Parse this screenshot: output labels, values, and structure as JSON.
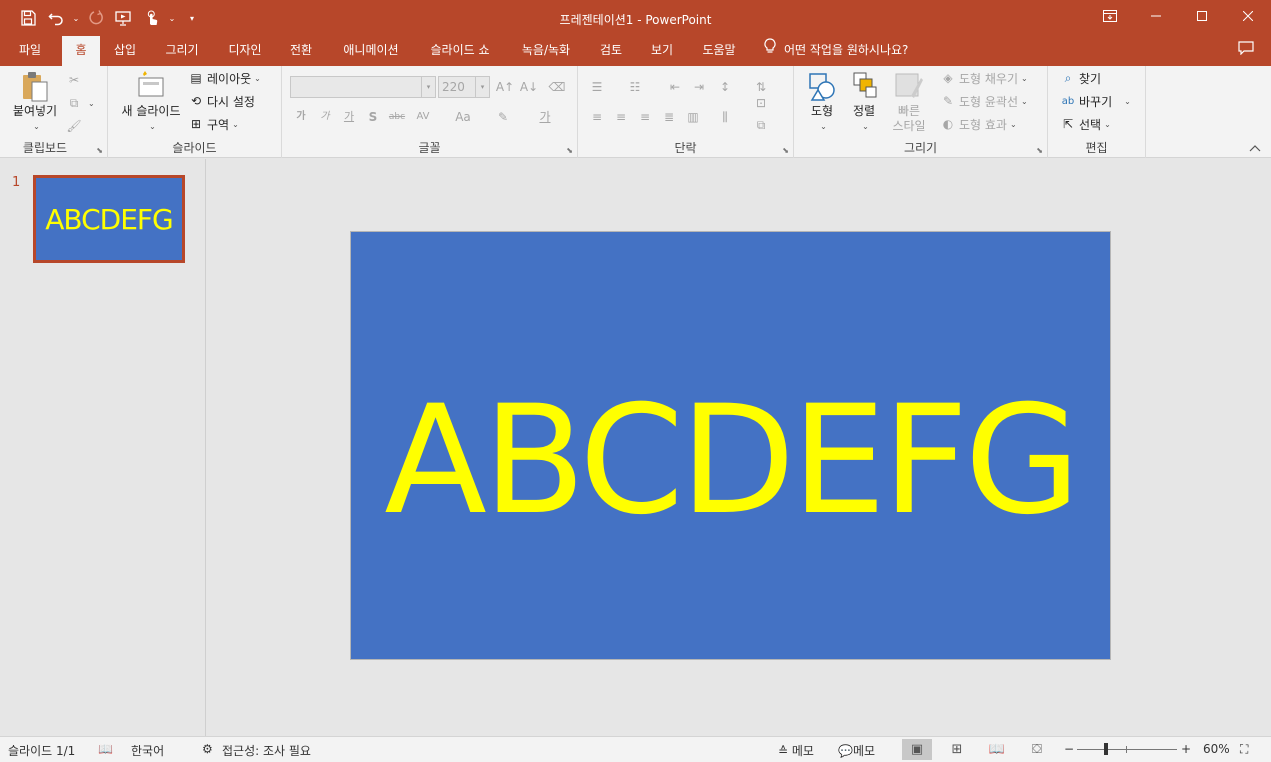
{
  "window": {
    "title": "프레젠테이션1 - PowerPoint"
  },
  "colors": {
    "accent": "#b7472a",
    "slide_bg": "#4472c4",
    "slide_text": "#ffff00",
    "ribbon_bg": "#f3f3f3"
  },
  "qat": {
    "save_icon": "save-icon",
    "undo_icon": "undo-icon",
    "redo_icon": "redo-icon",
    "present_icon": "present-from-start-icon",
    "touch_icon": "touch-mouse-mode-icon",
    "customize_icon": "customize-qat-icon"
  },
  "window_controls": {
    "ribbon_display": "ribbon-display-options-icon",
    "minimize": "minimize-icon",
    "maximize": "maximize-icon",
    "close": "close-icon"
  },
  "tabs": [
    "파일",
    "홈",
    "삽입",
    "그리기",
    "디자인",
    "전환",
    "애니메이션",
    "슬라이드 쇼",
    "녹음/녹화",
    "검토",
    "보기",
    "도움말"
  ],
  "active_tab": "홈",
  "tell_me": "어떤 작업을 원하시나요?",
  "ribbon": {
    "clipboard": {
      "label": "클립보드",
      "paste": "붙여넣기"
    },
    "slides": {
      "label": "슬라이드",
      "new_slide": "새 슬라이드",
      "layout": "레이아웃",
      "reset": "다시 설정",
      "section": "구역"
    },
    "font": {
      "label": "글꼴",
      "font_size": "220",
      "bold": "가",
      "italic": "가",
      "underline": "가",
      "shadow": "S",
      "strike": "abc",
      "spacing": "AV",
      "case": "Aa",
      "color": "가"
    },
    "paragraph": {
      "label": "단락"
    },
    "drawing": {
      "label": "그리기",
      "shapes": "도형",
      "arrange": "정렬",
      "quick_styles_1": "빠른",
      "quick_styles_2": "스타일",
      "fill": "도형 채우기",
      "outline": "도형 윤곽선",
      "effects": "도형 효과"
    },
    "editing": {
      "label": "편집",
      "find": "찾기",
      "replace": "바꾸기",
      "select": "선택"
    }
  },
  "thumbnails": [
    {
      "number": "1",
      "text": "ABCDEFG"
    }
  ],
  "slide": {
    "text": "ABCDEFG"
  },
  "status": {
    "slide_count": "슬라이드 1/1",
    "language": "한국어",
    "accessibility": "접근성: 조사 필요",
    "notes": "메모",
    "comments": "메모",
    "zoom": "60%",
    "zoom_value": 60
  }
}
